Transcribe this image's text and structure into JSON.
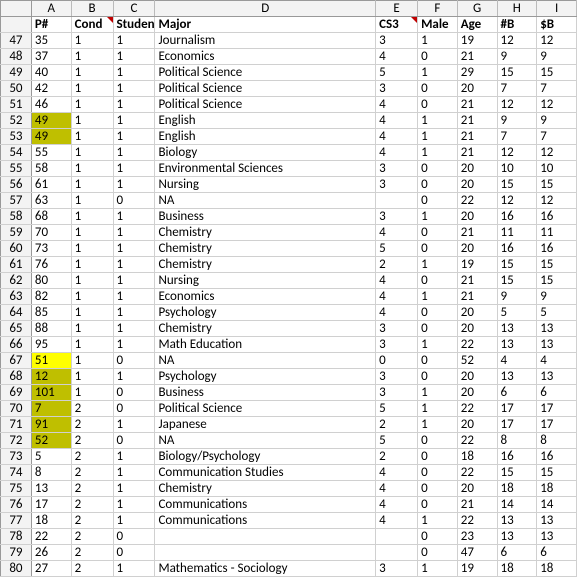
{
  "columns": [
    "A",
    "B",
    "C",
    "D",
    "E",
    "F",
    "G",
    "H",
    "I"
  ],
  "headerRowIndex": 0,
  "header": {
    "A": "P#",
    "B": "Cond",
    "C": "Student",
    "D": "Major",
    "E": "CS3",
    "F": "Male",
    "G": "Age",
    "H": "#B",
    "I": "$B"
  },
  "commentCols": [
    "B",
    "E"
  ],
  "rows": [
    {
      "n": 47,
      "A": "35",
      "B": "1",
      "C": "1",
      "D": "Journalism",
      "E": "3",
      "F": "1",
      "G": "19",
      "H": "12",
      "I": "12"
    },
    {
      "n": 48,
      "A": "37",
      "B": "1",
      "C": "1",
      "D": "Economics",
      "E": "4",
      "F": "0",
      "G": "21",
      "H": "9",
      "I": "9"
    },
    {
      "n": 49,
      "A": "40",
      "B": "1",
      "C": "1",
      "D": "Political Science",
      "E": "5",
      "F": "1",
      "G": "29",
      "H": "15",
      "I": "15"
    },
    {
      "n": 50,
      "A": "42",
      "B": "1",
      "C": "1",
      "D": "Political Science",
      "E": "3",
      "F": "0",
      "G": "20",
      "H": "7",
      "I": "7"
    },
    {
      "n": 51,
      "A": "46",
      "B": "1",
      "C": "1",
      "D": "Political Science",
      "E": "4",
      "F": "0",
      "G": "21",
      "H": "12",
      "I": "12"
    },
    {
      "n": 52,
      "A": "49",
      "B": "1",
      "C": "1",
      "D": "English",
      "E": "4",
      "F": "1",
      "G": "21",
      "H": "9",
      "I": "9",
      "hlA": "olive"
    },
    {
      "n": 53,
      "A": "49",
      "B": "1",
      "C": "1",
      "D": "English",
      "E": "4",
      "F": "1",
      "G": "21",
      "H": "7",
      "I": "7",
      "hlA": "olive"
    },
    {
      "n": 54,
      "A": "55",
      "B": "1",
      "C": "1",
      "D": "Biology",
      "E": "4",
      "F": "1",
      "G": "21",
      "H": "12",
      "I": "12"
    },
    {
      "n": 55,
      "A": "58",
      "B": "1",
      "C": "1",
      "D": "Environmental Sciences",
      "E": "3",
      "F": "0",
      "G": "20",
      "H": "10",
      "I": "10"
    },
    {
      "n": 56,
      "A": "61",
      "B": "1",
      "C": "1",
      "D": "Nursing",
      "E": "3",
      "F": "0",
      "G": "20",
      "H": "15",
      "I": "15"
    },
    {
      "n": 57,
      "A": "63",
      "B": "1",
      "C": "0",
      "D": "NA",
      "E": "",
      "F": "0",
      "G": "22",
      "H": "12",
      "I": "12"
    },
    {
      "n": 58,
      "A": "68",
      "B": "1",
      "C": "1",
      "D": "Business",
      "E": "3",
      "F": "1",
      "G": "20",
      "H": "16",
      "I": "16"
    },
    {
      "n": 59,
      "A": "70",
      "B": "1",
      "C": "1",
      "D": "Chemistry",
      "E": "4",
      "F": "0",
      "G": "21",
      "H": "11",
      "I": "11"
    },
    {
      "n": 60,
      "A": "73",
      "B": "1",
      "C": "1",
      "D": "Chemistry",
      "E": "5",
      "F": "0",
      "G": "20",
      "H": "16",
      "I": "16"
    },
    {
      "n": 61,
      "A": "76",
      "B": "1",
      "C": "1",
      "D": "Chemistry",
      "E": "2",
      "F": "1",
      "G": "19",
      "H": "15",
      "I": "15"
    },
    {
      "n": 62,
      "A": "80",
      "B": "1",
      "C": "1",
      "D": "Nursing",
      "E": "4",
      "F": "0",
      "G": "21",
      "H": "15",
      "I": "15"
    },
    {
      "n": 63,
      "A": "82",
      "B": "1",
      "C": "1",
      "D": "Economics",
      "E": "4",
      "F": "1",
      "G": "21",
      "H": "9",
      "I": "9"
    },
    {
      "n": 64,
      "A": "85",
      "B": "1",
      "C": "1",
      "D": "Psychology",
      "E": "4",
      "F": "0",
      "G": "20",
      "H": "5",
      "I": "5"
    },
    {
      "n": 65,
      "A": "88",
      "B": "1",
      "C": "1",
      "D": "Chemistry",
      "E": "3",
      "F": "0",
      "G": "20",
      "H": "13",
      "I": "13"
    },
    {
      "n": 66,
      "A": "95",
      "B": "1",
      "C": "1",
      "D": "Math Education",
      "E": "3",
      "F": "1",
      "G": "22",
      "H": "13",
      "I": "13"
    },
    {
      "n": 67,
      "A": "51",
      "B": "1",
      "C": "0",
      "D": "NA",
      "E": "0",
      "F": "0",
      "G": "52",
      "H": "4",
      "I": "4",
      "hlA": "yellow"
    },
    {
      "n": 68,
      "A": "12",
      "B": "1",
      "C": "1",
      "D": "Psychology",
      "E": "3",
      "F": "0",
      "G": "20",
      "H": "13",
      "I": "13",
      "hlA": "olive"
    },
    {
      "n": 69,
      "A": "101",
      "B": "1",
      "C": "0",
      "D": "Business",
      "E": "3",
      "F": "1",
      "G": "20",
      "H": "6",
      "I": "6",
      "hlA": "olive"
    },
    {
      "n": 70,
      "A": "7",
      "B": "2",
      "C": "0",
      "D": "Political Science",
      "E": "5",
      "F": "1",
      "G": "22",
      "H": "17",
      "I": "17",
      "hlA": "olive"
    },
    {
      "n": 71,
      "A": "91",
      "B": "2",
      "C": "1",
      "D": "Japanese",
      "E": "2",
      "F": "1",
      "G": "20",
      "H": "17",
      "I": "17",
      "hlA": "olive"
    },
    {
      "n": 72,
      "A": "52",
      "B": "2",
      "C": "0",
      "D": "NA",
      "E": "5",
      "F": "0",
      "G": "22",
      "H": "8",
      "I": "8",
      "hlA": "olive"
    },
    {
      "n": 73,
      "A": "5",
      "B": "2",
      "C": "1",
      "D": "Biology/Psychology",
      "E": "2",
      "F": "0",
      "G": "18",
      "H": "16",
      "I": "16"
    },
    {
      "n": 74,
      "A": "8",
      "B": "2",
      "C": "1",
      "D": "Communication Studies",
      "E": "4",
      "F": "0",
      "G": "22",
      "H": "15",
      "I": "15"
    },
    {
      "n": 75,
      "A": "13",
      "B": "2",
      "C": "1",
      "D": "Chemistry",
      "E": "4",
      "F": "0",
      "G": "20",
      "H": "18",
      "I": "18"
    },
    {
      "n": 76,
      "A": "17",
      "B": "2",
      "C": "1",
      "D": "Communications",
      "E": "4",
      "F": "0",
      "G": "21",
      "H": "14",
      "I": "14"
    },
    {
      "n": 77,
      "A": "18",
      "B": "2",
      "C": "1",
      "D": "Communications",
      "E": "4",
      "F": "1",
      "G": "22",
      "H": "13",
      "I": "13"
    },
    {
      "n": 78,
      "A": "22",
      "B": "2",
      "C": "0",
      "D": "",
      "E": "",
      "F": "0",
      "G": "23",
      "H": "13",
      "I": "13"
    },
    {
      "n": 79,
      "A": "26",
      "B": "2",
      "C": "0",
      "D": "",
      "E": "",
      "F": "0",
      "G": "47",
      "H": "6",
      "I": "6"
    },
    {
      "n": 80,
      "A": "27",
      "B": "2",
      "C": "1",
      "D": "Mathematics - Sociology",
      "E": "3",
      "F": "1",
      "G": "19",
      "H": "18",
      "I": "18"
    }
  ]
}
